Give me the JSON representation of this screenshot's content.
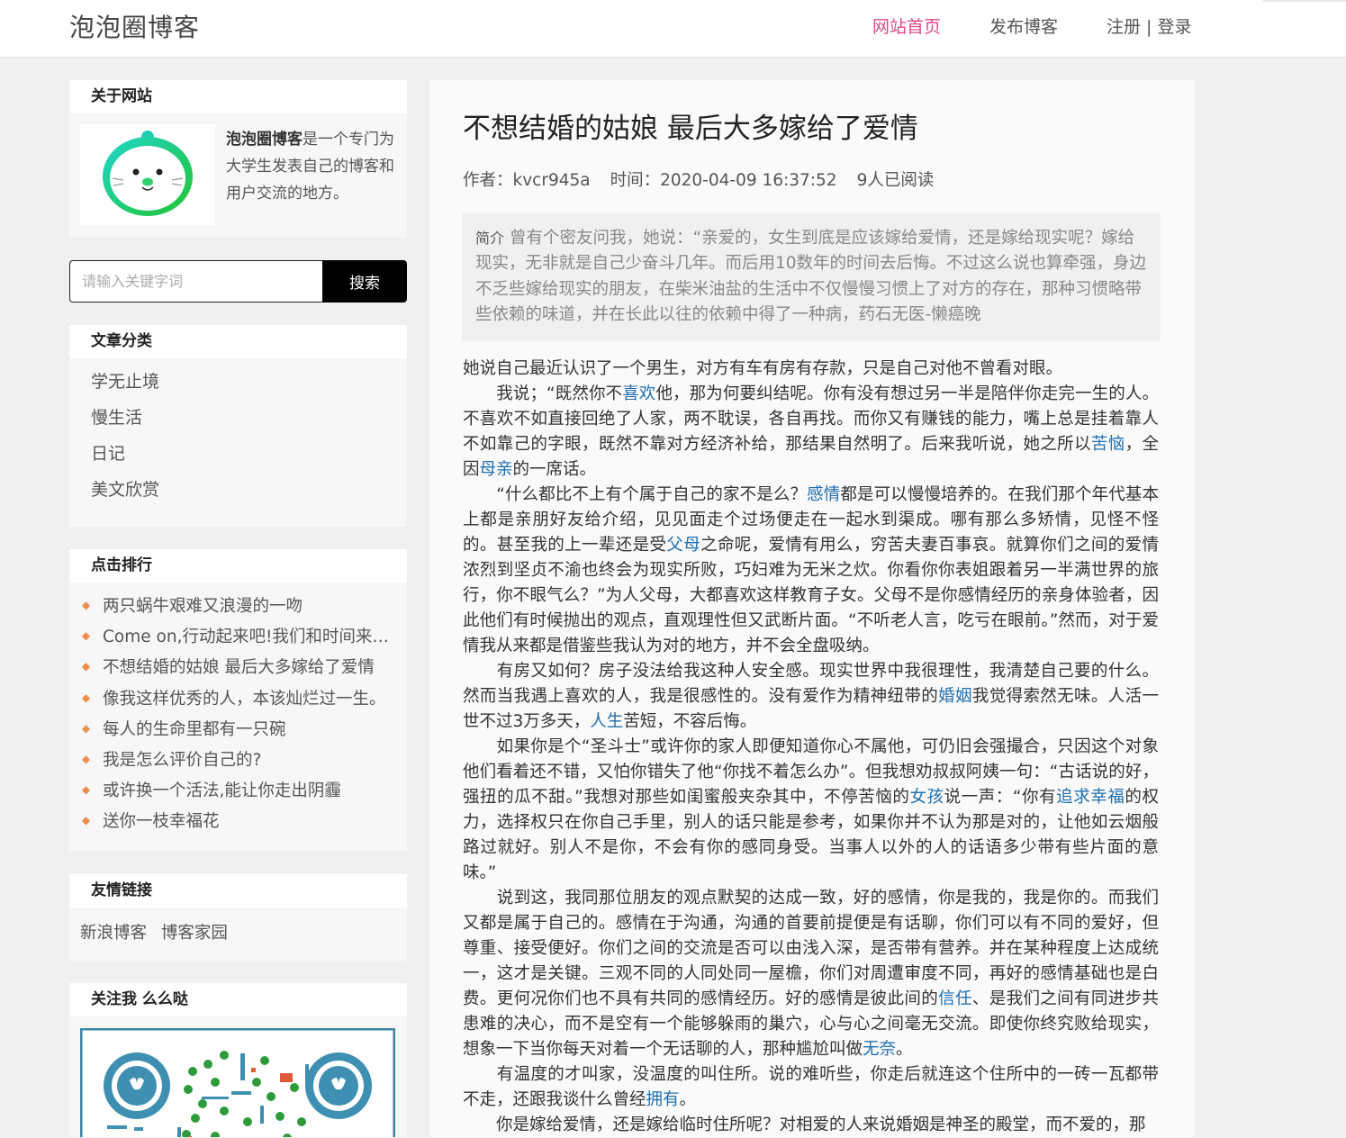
{
  "header": {
    "logo": "泡泡圈博客",
    "nav": [
      {
        "label": "网站首页",
        "active": true
      },
      {
        "label": "发布博客",
        "active": false
      }
    ],
    "register": "注册",
    "separator": " | ",
    "login": "登录"
  },
  "about": {
    "title": "关于网站",
    "site_name": "泡泡圈博客",
    "description": "是一个专门为大学生发表自己的博客和用户交流的地方。"
  },
  "search": {
    "placeholder": "请输入关键字词",
    "button": "搜索"
  },
  "categories": {
    "title": "文章分类",
    "items": [
      "学无止境",
      "慢生活",
      "日记",
      "美文欣赏"
    ]
  },
  "ranking": {
    "title": "点击排行",
    "items": [
      "两只蜗牛艰难又浪漫的一吻",
      "Come on,行动起来吧!我们和时间来…",
      "不想结婚的姑娘 最后大多嫁给了爱情",
      "像我这样优秀的人，本该灿烂过一生。",
      "每人的生命里都有一只碗",
      "我是怎么评价自己的?",
      "或许换一个活法,能让你走出阴霾",
      "送你一枝幸福花"
    ]
  },
  "links": {
    "title": "友情链接",
    "items": [
      "新浪博客",
      "博客家园"
    ]
  },
  "follow": {
    "title": "关注我 么么哒"
  },
  "article": {
    "title": "不想结婚的姑娘 最后大多嫁给了爱情",
    "author": "作者：kvcr945a",
    "time": "时间：2020-04-09 16:37:52",
    "reads": "9人已阅读",
    "summary_label": "简介",
    "summary": "曾有个密友问我，她说：“亲爱的，女生到底是应该嫁给爱情，还是嫁给现实呢？嫁给现实，无非就是自己少奋斗几年。而后用10数年的时间去后悔。不过这么说也算牵强，身边不乏些嫁给现实的朋友，在柴米油盐的生活中不仅慢慢习惯上了对方的存在，那种习惯略带些依赖的味道，并在长此以往的依赖中得了一种病，药石无医-懒癌晚",
    "paragraphs": [
      [
        {
          "t": "她说自己最近认识了一个男生，对方有车有房有存款，只是自己对他不曾看对眼。"
        }
      ],
      [
        {
          "t": "　　我说；“既然你不"
        },
        {
          "t": "喜欢",
          "link": true
        },
        {
          "t": "他，那为何要纠结呢。你有没有想过另一半是陪伴你走完一生的人。不喜欢不如直接回绝了人家，两不耽误，各自再找。而你又有赚钱的能力，嘴上总是挂着靠人不如靠己的字眼，既然不靠对方经济补给，那结果自然明了。后来我听说，她之所以"
        },
        {
          "t": "苦恼",
          "link": true
        },
        {
          "t": "，全因"
        },
        {
          "t": "母亲",
          "link": true
        },
        {
          "t": "的一席话。"
        }
      ],
      [
        {
          "t": "　　“什么都比不上有个属于自己的家不是么？"
        },
        {
          "t": "感情",
          "link": true
        },
        {
          "t": "都是可以慢慢培养的。在我们那个年代基本上都是亲朋好友给介绍，见见面走个过场便走在一起水到渠成。哪有那么多矫情，见怪不怪的。甚至我的上一辈还是受"
        },
        {
          "t": "父母",
          "link": true
        },
        {
          "t": "之命呢，爱情有用么，穷苦夫妻百事哀。就算你们之间的爱情浓烈到坚贞不渝也终会为现实所败，巧妇难为无米之炊。你看你你表姐跟着另一半满世界的旅行，你不眼气么？”为人父母，大都喜欢这样教育子女。父母不是你感情经历的亲身体验者，因此他们有时候抛出的观点，直观理性但又武断片面。“不听老人言，吃亏在眼前。”然而，对于爱情我从来都是借鉴些我认为对的地方，并不会全盘吸纳。"
        }
      ],
      [
        {
          "t": "　　有房又如何？房子没法给我这种人安全感。现实世界中我很理性，我清楚自己要的什么。然而当我遇上喜欢的人，我是很感性的。没有爱作为精神纽带的"
        },
        {
          "t": "婚姻",
          "link": true
        },
        {
          "t": "我觉得索然无味。人活一世不过3万多天，"
        },
        {
          "t": "人生",
          "link": true
        },
        {
          "t": "苦短，不容后悔。"
        }
      ],
      [
        {
          "t": "　　如果你是个“圣斗士”或许你的家人即便知道你心不属他，可仍旧会强撮合，只因这个对象他们看着还不错，又怕你错失了他“你找不着怎么办”。但我想劝叔叔阿姨一句：“古话说的好，强扭的瓜不甜。”我想对那些如闺蜜般夹杂其中，不停苦恼的"
        },
        {
          "t": "女孩",
          "link": true
        },
        {
          "t": "说一声：“你有"
        },
        {
          "t": "追求幸福",
          "link": true
        },
        {
          "t": "的权力，选择权只在你自己手里，别人的话只能是参考，如果你并不认为那是对的，让他如云烟般路过就好。别人不是你，不会有你的感同身受。当事人以外的人的话语多少带有些片面的意味。”"
        }
      ],
      [
        {
          "t": "　　说到这，我同那位朋友的观点默契的达成一致，好的感情，你是我的，我是你的。而我们又都是属于自己的。感情在于沟通，沟通的首要前提便是有话聊，你们可以有不同的爱好，但尊重、接受便好。你们之间的交流是否可以由浅入深，是否带有营养。并在某种程度上达成统一，这才是关键。三观不同的人同处同一屋檐，你们对周遭审度不同，再好的感情基础也是白费。更何况你们也不具有共同的感情经历。好的感情是彼此间的"
        },
        {
          "t": "信任",
          "link": true
        },
        {
          "t": "、是我们之间有同进步共患难的决心，而不是空有一个能够躲雨的巢穴，心与心之间毫无交流。即使你终究败给现实，想象一下当你每天对着一个无话聊的人，那种尴尬叫做"
        },
        {
          "t": "无奈",
          "link": true
        },
        {
          "t": "。"
        }
      ],
      [
        {
          "t": "　　有温度的才叫家，没温度的叫住所。说的难听些，你走后就连这个住所中的一砖一瓦都带不走，还跟我谈什么曾经"
        },
        {
          "t": "拥有",
          "link": true
        },
        {
          "t": "。"
        }
      ],
      [
        {
          "t": "　　你是嫁给爱情，还是嫁给临时住所呢？对相爱的人来说婚姻是神圣的殿堂，而不爱的，那"
        }
      ]
    ]
  }
}
